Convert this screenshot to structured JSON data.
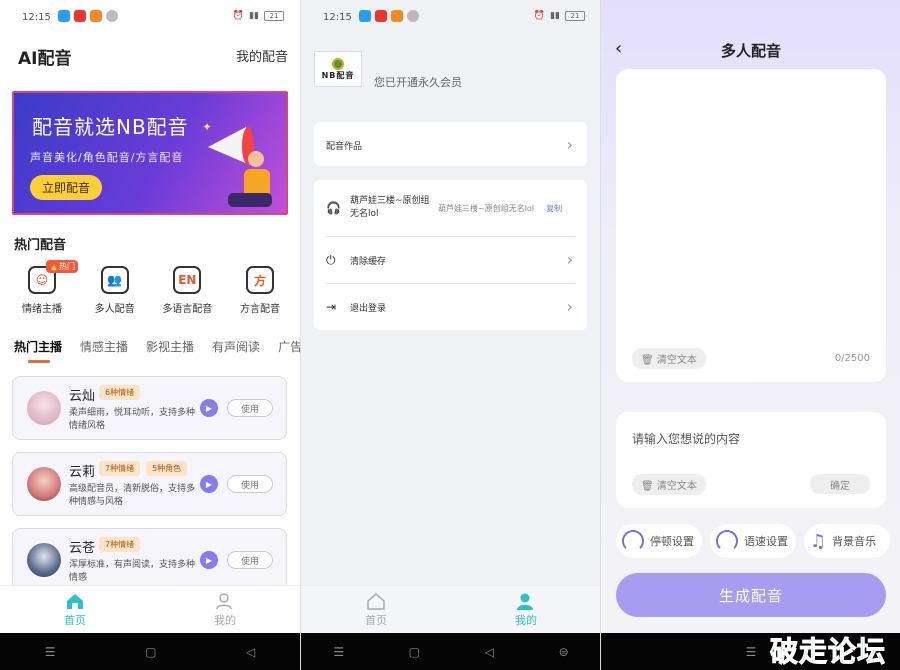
{
  "status": {
    "time": "12:15",
    "battery": "21"
  },
  "screen1": {
    "title": "AI配音",
    "mine_link": "我的配音",
    "banner": {
      "headline": "配音就选NB配音",
      "subtitle": "声音美化/角色配音/方言配音",
      "cta": "立即配音"
    },
    "section_title": "热门配音",
    "features": [
      {
        "label": "情绪主播",
        "icon_text": "☺",
        "badge": "🔥热门"
      },
      {
        "label": "多人配音",
        "icon_text": "👥"
      },
      {
        "label": "多语言配音",
        "icon_text": "EN"
      },
      {
        "label": "方言配音",
        "icon_text": "方"
      }
    ],
    "tabs": [
      "热门主播",
      "情感主播",
      "影视主播",
      "有声阅读",
      "广告"
    ],
    "voices": [
      {
        "name": "云灿",
        "tags": [
          "6种情绪"
        ],
        "desc": "柔声细雨，悦耳动听，支持多种情绪风格",
        "use": "使用"
      },
      {
        "name": "云莉",
        "tags": [
          "7种情绪",
          "5种角色"
        ],
        "desc": "高级配音员，清新脱俗，支持多种情感与风格",
        "use": "使用"
      },
      {
        "name": "云苍",
        "tags": [
          "7种情绪"
        ],
        "desc": "浑厚标准，有声阅读，支持多种情感",
        "use": "使用"
      }
    ],
    "nav": {
      "home": "首页",
      "mine": "我的"
    }
  },
  "screen2": {
    "logo_text": "NB配音",
    "member_text": "您已开通永久会员",
    "works": "配音作品",
    "account": "葫芦娃三楼~原创组无名lol",
    "account_side": "葫芦娃三楼~原创组无名lol",
    "copy": "复制",
    "clear_cache": "清除缓存",
    "logout": "退出登录",
    "nav": {
      "home": "首页",
      "mine": "我的"
    }
  },
  "screen3": {
    "title": "多人配音",
    "clear_label": "清空文本",
    "counter": "0/2500",
    "input_placeholder": "请输入您想说的内容",
    "clear_label2": "清空文本",
    "confirm": "确定",
    "settings": [
      "停顿设置",
      "语速设置",
      "背景音乐"
    ],
    "generate": "生成配音"
  },
  "watermark": "破走论坛",
  "colors": {
    "accent_teal": "#2bc3c6",
    "purple": "#a89cf0",
    "orange_tab": "#e66b3a"
  }
}
